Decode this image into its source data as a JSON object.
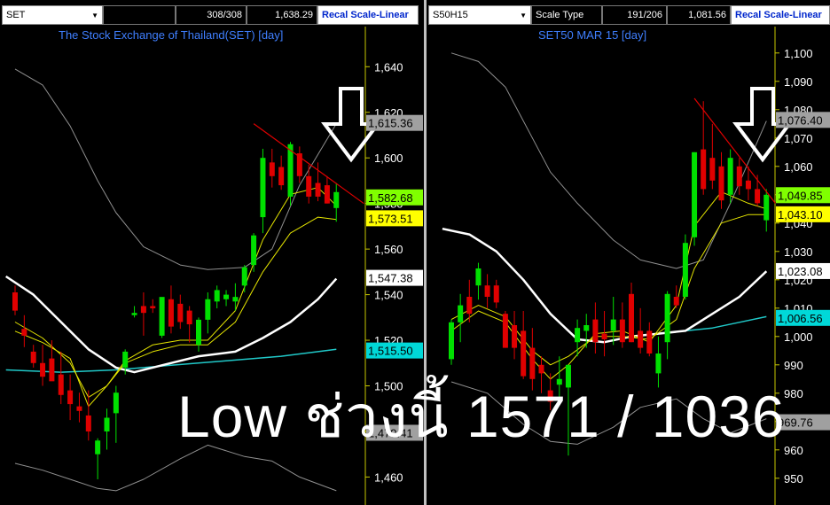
{
  "overlay_text": "Low ช่วงนี้ 1571 / 1036",
  "colors": {
    "up": "#00e000",
    "down": "#e00000",
    "upper_band": "#909090",
    "ma_fast": "#e6e600",
    "ma_slow": "#ffffff",
    "ma_long": "#20c8c8",
    "trend": "#e00000",
    "arrow": "#ffffff",
    "title": "#3f7fff"
  },
  "panels": [
    {
      "symbol": "SET",
      "scale_label": "",
      "counter": "308/308",
      "price": "1,638.29",
      "recal": "Recal Scale-Linear",
      "title": "The Stock Exchange of Thailand(SET) [day]"
    },
    {
      "symbol": "S50H15",
      "scale_label": "Scale Type",
      "counter": "191/206",
      "price": "1,081.56",
      "recal": "Recal Scale-Linear",
      "title": "SET50 MAR 15   [day]"
    }
  ],
  "chart_data": [
    {
      "type": "candlestick",
      "title": "The Stock Exchange of Thailand(SET) [day]",
      "ylim": [
        1452,
        1651
      ],
      "y_ticks": [
        1460,
        1480,
        1500,
        1520,
        1540,
        1560,
        1580,
        1600,
        1620,
        1640
      ],
      "y_tick_labels": [
        "1,460",
        "1,480",
        "1,500",
        "1,520",
        "1,540",
        "1,560",
        "1,580",
        "1,600",
        "1,620",
        "1,640"
      ],
      "candles": [
        {
          "o": 1541,
          "h": 1544,
          "l": 1531,
          "c": 1533
        },
        {
          "o": 1525,
          "h": 1531,
          "l": 1517,
          "c": 1522
        },
        {
          "o": 1515,
          "h": 1518,
          "l": 1508,
          "c": 1510
        },
        {
          "o": 1510,
          "h": 1518,
          "l": 1500,
          "c": 1504
        },
        {
          "o": 1512,
          "h": 1520,
          "l": 1504,
          "c": 1502
        },
        {
          "o": 1505,
          "h": 1515,
          "l": 1492,
          "c": 1496
        },
        {
          "o": 1498,
          "h": 1505,
          "l": 1485,
          "c": 1492
        },
        {
          "o": 1491,
          "h": 1497,
          "l": 1484,
          "c": 1489
        },
        {
          "o": 1487,
          "h": 1498,
          "l": 1476,
          "c": 1480
        },
        {
          "o": 1470,
          "h": 1477,
          "l": 1459,
          "c": 1476
        },
        {
          "o": 1480,
          "h": 1490,
          "l": 1472,
          "c": 1486
        },
        {
          "o": 1488,
          "h": 1500,
          "l": 1475,
          "c": 1497
        },
        {
          "o": 1508,
          "h": 1516,
          "l": 1505,
          "c": 1515
        },
        {
          "o": 1531,
          "h": 1535,
          "l": 1530,
          "c": 1532
        },
        {
          "o": 1535,
          "h": 1541,
          "l": 1522,
          "c": 1532
        },
        {
          "o": 1535,
          "h": 1538,
          "l": 1532,
          "c": 1534
        },
        {
          "o": 1522,
          "h": 1532,
          "l": 1521,
          "c": 1539
        },
        {
          "o": 1538,
          "h": 1544,
          "l": 1523,
          "c": 1526
        },
        {
          "o": 1536,
          "h": 1540,
          "l": 1525,
          "c": 1528
        },
        {
          "o": 1533,
          "h": 1535,
          "l": 1519,
          "c": 1527
        },
        {
          "o": 1518,
          "h": 1530,
          "l": 1515,
          "c": 1529
        },
        {
          "o": 1529,
          "h": 1541,
          "l": 1523,
          "c": 1538
        },
        {
          "o": 1537,
          "h": 1544,
          "l": 1534,
          "c": 1542
        },
        {
          "o": 1538,
          "h": 1542,
          "l": 1535,
          "c": 1540
        },
        {
          "o": 1537,
          "h": 1545,
          "l": 1533,
          "c": 1539
        },
        {
          "o": 1544,
          "h": 1553,
          "l": 1541,
          "c": 1552
        },
        {
          "o": 1553,
          "h": 1567,
          "l": 1550,
          "c": 1566
        },
        {
          "o": 1574,
          "h": 1604,
          "l": 1567,
          "c": 1600
        },
        {
          "o": 1598,
          "h": 1604,
          "l": 1587,
          "c": 1592
        },
        {
          "o": 1596,
          "h": 1601,
          "l": 1586,
          "c": 1588
        },
        {
          "o": 1583,
          "h": 1607,
          "l": 1579,
          "c": 1606
        },
        {
          "o": 1602,
          "h": 1605,
          "l": 1589,
          "c": 1592
        },
        {
          "o": 1592,
          "h": 1597,
          "l": 1580,
          "c": 1583
        },
        {
          "o": 1589,
          "h": 1598,
          "l": 1581,
          "c": 1583
        },
        {
          "o": 1588,
          "h": 1592,
          "l": 1580,
          "c": 1580
        },
        {
          "o": 1578,
          "h": 1589,
          "l": 1572,
          "c": 1585
        }
      ],
      "upper_band": [
        [
          0,
          1639
        ],
        [
          3,
          1632
        ],
        [
          6,
          1614
        ],
        [
          9,
          1590
        ],
        [
          11,
          1576
        ],
        [
          14,
          1561
        ],
        [
          18,
          1553
        ],
        [
          21,
          1551
        ],
        [
          25,
          1552
        ],
        [
          28,
          1560
        ],
        [
          31,
          1588
        ],
        [
          35,
          1615
        ]
      ],
      "lower_band": [
        [
          0,
          1466
        ],
        [
          3,
          1463
        ],
        [
          6,
          1459
        ],
        [
          9,
          1455
        ],
        [
          11,
          1454
        ],
        [
          14,
          1459
        ],
        [
          18,
          1468
        ],
        [
          21,
          1474
        ],
        [
          25,
          1469
        ],
        [
          28,
          1467
        ],
        [
          31,
          1460
        ],
        [
          35,
          1454
        ]
      ],
      "ma_fast": [
        [
          0,
          1528
        ],
        [
          3,
          1521
        ],
        [
          6,
          1510
        ],
        [
          8,
          1495
        ],
        [
          10,
          1500
        ],
        [
          12,
          1511
        ],
        [
          15,
          1518
        ],
        [
          18,
          1520
        ],
        [
          21,
          1520
        ],
        [
          24,
          1533
        ],
        [
          27,
          1564
        ],
        [
          30,
          1584
        ],
        [
          33,
          1587
        ],
        [
          35,
          1579
        ]
      ],
      "ma_mid": [
        [
          0,
          1524
        ],
        [
          3,
          1519
        ],
        [
          6,
          1512
        ],
        [
          8,
          1491
        ],
        [
          10,
          1500
        ],
        [
          12,
          1510
        ],
        [
          15,
          1515
        ],
        [
          18,
          1518
        ],
        [
          21,
          1518
        ],
        [
          24,
          1528
        ],
        [
          27,
          1550
        ],
        [
          30,
          1567
        ],
        [
          33,
          1574
        ],
        [
          35,
          1573
        ]
      ],
      "ma_slow": [
        [
          -1,
          1548
        ],
        [
          2,
          1540
        ],
        [
          5,
          1528
        ],
        [
          8,
          1516
        ],
        [
          11,
          1508
        ],
        [
          13,
          1506
        ],
        [
          16,
          1509
        ],
        [
          20,
          1513
        ],
        [
          24,
          1515
        ],
        [
          27,
          1521
        ],
        [
          30,
          1528
        ],
        [
          33,
          1538
        ],
        [
          35,
          1547
        ]
      ],
      "ma_long": [
        [
          -1,
          1507
        ],
        [
          5,
          1506
        ],
        [
          11,
          1507
        ],
        [
          17,
          1509
        ],
        [
          23,
          1511
        ],
        [
          29,
          1513
        ],
        [
          35,
          1516
        ]
      ],
      "trendline": [
        [
          26,
          1615
        ],
        [
          38,
          1580
        ]
      ],
      "price_labels": [
        {
          "text": "1,615.36",
          "y": 1615.36,
          "bg": "#a0a0a0",
          "fg": "#000"
        },
        {
          "text": "1,582.68",
          "y": 1582.68,
          "bg": "#80ff00",
          "fg": "#000"
        },
        {
          "text": "1,573.51",
          "y": 1573.51,
          "bg": "#ffff00",
          "fg": "#000"
        },
        {
          "text": "1,547.38",
          "y": 1547.38,
          "bg": "#ffffff",
          "fg": "#000"
        },
        {
          "text": "1,515.50",
          "y": 1515.5,
          "bg": "#00d8d8",
          "fg": "#000"
        },
        {
          "text": "1,479.41",
          "y": 1479.41,
          "bg": "#a0a0a0",
          "fg": "#000"
        }
      ]
    },
    {
      "type": "candlestick",
      "title": "SET50 MAR 15   [day]",
      "ylim": [
        944,
        1104
      ],
      "y_ticks": [
        950,
        960,
        970,
        980,
        990,
        1000,
        1010,
        1020,
        1030,
        1040,
        1050,
        1060,
        1070,
        1080,
        1090,
        1100
      ],
      "y_tick_labels": [
        "950",
        "960",
        "970",
        "980",
        "990",
        "1,000",
        "1,010",
        "1,020",
        "1,030",
        "1,040",
        "1,050",
        "1,060",
        "1,070",
        "1,080",
        "1,090",
        "1,100"
      ],
      "candles": [
        {
          "o": 992,
          "h": 1006,
          "l": 990,
          "c": 1005
        },
        {
          "o": 1005,
          "h": 1015,
          "l": 998,
          "c": 1011
        },
        {
          "o": 1014,
          "h": 1020,
          "l": 1005,
          "c": 1008
        },
        {
          "o": 1018,
          "h": 1026,
          "l": 1013,
          "c": 1024
        },
        {
          "o": 1018,
          "h": 1022,
          "l": 1010,
          "c": 1014
        },
        {
          "o": 1018,
          "h": 1020,
          "l": 1010,
          "c": 1012
        },
        {
          "o": 1008,
          "h": 1009,
          "l": 996,
          "c": 996
        },
        {
          "o": 1004,
          "h": 1009,
          "l": 992,
          "c": 996
        },
        {
          "o": 1002,
          "h": 1009,
          "l": 985,
          "c": 986
        },
        {
          "o": 996,
          "h": 1003,
          "l": 981,
          "c": 985
        },
        {
          "o": 990,
          "h": 993,
          "l": 980,
          "c": 987
        },
        {
          "o": 981,
          "h": 987,
          "l": 974,
          "c": 977
        },
        {
          "o": 983,
          "h": 993,
          "l": 978,
          "c": 985
        },
        {
          "o": 982,
          "h": 990,
          "l": 958,
          "c": 990
        },
        {
          "o": 998,
          "h": 1006,
          "l": 993,
          "c": 1003
        },
        {
          "o": 1002,
          "h": 1008,
          "l": 996,
          "c": 1004
        },
        {
          "o": 1006,
          "h": 1012,
          "l": 994,
          "c": 998
        },
        {
          "o": 1001,
          "h": 1009,
          "l": 993,
          "c": 999
        },
        {
          "o": 1002,
          "h": 1014,
          "l": 997,
          "c": 1006
        },
        {
          "o": 1006,
          "h": 1012,
          "l": 996,
          "c": 998
        },
        {
          "o": 1015,
          "h": 1019,
          "l": 998,
          "c": 998
        },
        {
          "o": 1002,
          "h": 1010,
          "l": 994,
          "c": 996
        },
        {
          "o": 1002,
          "h": 1005,
          "l": 993,
          "c": 994
        },
        {
          "o": 987,
          "h": 1000,
          "l": 982,
          "c": 994
        },
        {
          "o": 998,
          "h": 1016,
          "l": 992,
          "c": 1015
        },
        {
          "o": 1014,
          "h": 1018,
          "l": 1010,
          "c": 1011
        },
        {
          "o": 1014,
          "h": 1036,
          "l": 1013,
          "c": 1033
        },
        {
          "o": 1035,
          "h": 1065,
          "l": 1032,
          "c": 1065
        },
        {
          "o": 1066,
          "h": 1083,
          "l": 1050,
          "c": 1052
        },
        {
          "o": 1063,
          "h": 1075,
          "l": 1052,
          "c": 1055
        },
        {
          "o": 1060,
          "h": 1065,
          "l": 1045,
          "c": 1048
        },
        {
          "o": 1050,
          "h": 1066,
          "l": 1047,
          "c": 1063
        },
        {
          "o": 1060,
          "h": 1063,
          "l": 1050,
          "c": 1053
        },
        {
          "o": 1055,
          "h": 1060,
          "l": 1048,
          "c": 1052
        },
        {
          "o": 1052,
          "h": 1057,
          "l": 1046,
          "c": 1047
        },
        {
          "o": 1041,
          "h": 1052,
          "l": 1037,
          "c": 1050
        }
      ],
      "upper_band": [
        [
          0,
          1100
        ],
        [
          3,
          1097
        ],
        [
          6,
          1088
        ],
        [
          9,
          1070
        ],
        [
          11,
          1058
        ],
        [
          14,
          1047
        ],
        [
          18,
          1034
        ],
        [
          21,
          1027
        ],
        [
          25,
          1024
        ],
        [
          28,
          1027
        ],
        [
          31,
          1047
        ],
        [
          35,
          1076
        ]
      ],
      "lower_band": [
        [
          0,
          984
        ],
        [
          4,
          980
        ],
        [
          8,
          969
        ],
        [
          11,
          963
        ],
        [
          14,
          962
        ],
        [
          18,
          968
        ],
        [
          21,
          975
        ],
        [
          25,
          978
        ],
        [
          28,
          971
        ],
        [
          31,
          966
        ],
        [
          35,
          971
        ]
      ],
      "ma_fast": [
        [
          0,
          1002
        ],
        [
          3,
          1009
        ],
        [
          6,
          1005
        ],
        [
          9,
          992
        ],
        [
          11,
          985
        ],
        [
          13,
          990
        ],
        [
          16,
          1001
        ],
        [
          19,
          1002
        ],
        [
          22,
          998
        ],
        [
          25,
          1011
        ],
        [
          27,
          1039
        ],
        [
          30,
          1051
        ],
        [
          33,
          1047
        ],
        [
          35,
          1045
        ]
      ],
      "ma_mid": [
        [
          0,
          1006
        ],
        [
          3,
          1011
        ],
        [
          6,
          1007
        ],
        [
          9,
          995
        ],
        [
          11,
          990
        ],
        [
          13,
          993
        ],
        [
          16,
          1000
        ],
        [
          19,
          1000
        ],
        [
          22,
          999
        ],
        [
          25,
          1006
        ],
        [
          27,
          1024
        ],
        [
          30,
          1040
        ],
        [
          33,
          1043
        ],
        [
          35,
          1043
        ]
      ],
      "ma_slow": [
        [
          -1,
          1038
        ],
        [
          2,
          1036
        ],
        [
          5,
          1030
        ],
        [
          8,
          1020
        ],
        [
          11,
          1008
        ],
        [
          14,
          999
        ],
        [
          17,
          998
        ],
        [
          20,
          1000
        ],
        [
          23,
          1001
        ],
        [
          26,
          1002
        ],
        [
          29,
          1008
        ],
        [
          32,
          1014
        ],
        [
          35,
          1023
        ]
      ],
      "ma_long": [
        [
          23,
          1001
        ],
        [
          26,
          1002
        ],
        [
          29,
          1003
        ],
        [
          32,
          1005
        ],
        [
          35,
          1007
        ]
      ],
      "trendline": [
        [
          27,
          1084
        ],
        [
          36,
          1047
        ]
      ],
      "price_labels": [
        {
          "text": "1,076.40",
          "y": 1076.4,
          "bg": "#a0a0a0",
          "fg": "#000"
        },
        {
          "text": "1,049.85",
          "y": 1049.85,
          "bg": "#80ff00",
          "fg": "#000"
        },
        {
          "text": "1,043.10",
          "y": 1043.1,
          "bg": "#ffff00",
          "fg": "#000"
        },
        {
          "text": "1,023.08",
          "y": 1023.08,
          "bg": "#ffffff",
          "fg": "#000"
        },
        {
          "text": "1,006.56",
          "y": 1006.56,
          "bg": "#00d8d8",
          "fg": "#000"
        },
        {
          "text": "969.76",
          "y": 969.76,
          "bg": "#a0a0a0",
          "fg": "#000"
        }
      ]
    }
  ]
}
